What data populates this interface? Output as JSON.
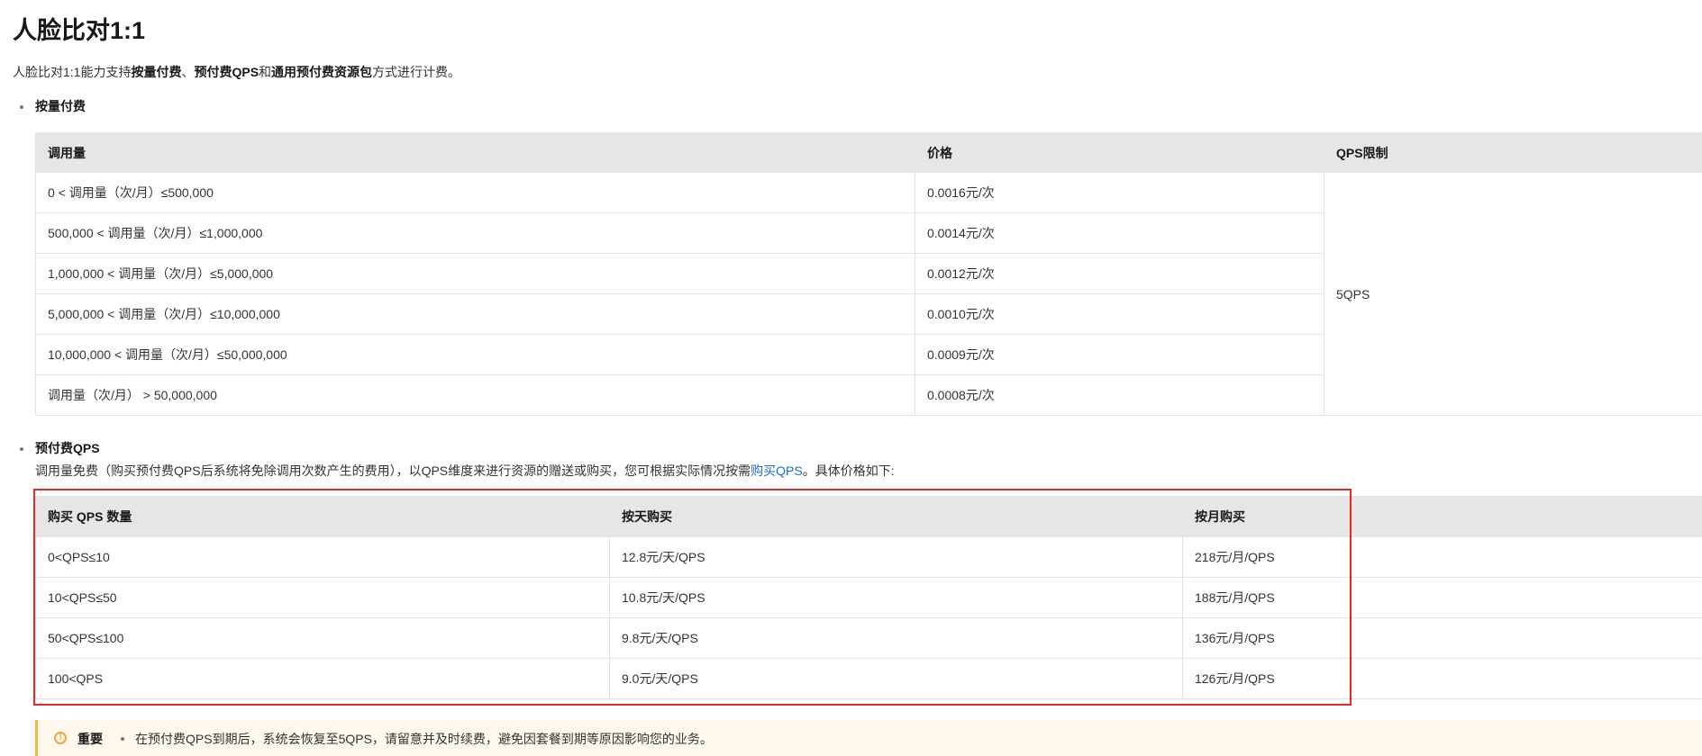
{
  "page": {
    "title": "人脸比对1:1",
    "intro": {
      "prefix": "人脸比对1:1能力支持",
      "b1": "按量付费",
      "sep1": "、",
      "b2": "预付费QPS",
      "sep2": "和",
      "b3": "通用预付费资源包",
      "suffix": "方式进行计费。"
    }
  },
  "pay_as_you_go": {
    "heading": "按量付费",
    "headers": [
      "调用量",
      "价格",
      "QPS限制"
    ],
    "rows": [
      {
        "range": "0 < 调用量（次/月）≤500,000",
        "price": "0.0016元/次"
      },
      {
        "range": "500,000 < 调用量（次/月）≤1,000,000",
        "price": "0.0014元/次"
      },
      {
        "range": "1,000,000 < 调用量（次/月）≤5,000,000",
        "price": "0.0012元/次"
      },
      {
        "range": "5,000,000 < 调用量（次/月）≤10,000,000",
        "price": "0.0010元/次"
      },
      {
        "range": "10,000,000 < 调用量（次/月）≤50,000,000",
        "price": "0.0009元/次"
      },
      {
        "range": "调用量（次/月） > 50,000,000",
        "price": "0.0008元/次"
      }
    ],
    "qps_limit": "5QPS"
  },
  "prepaid_qps": {
    "heading": "预付费QPS",
    "desc_prefix": "调用量免费（购买预付费QPS后系统将免除调用次数产生的费用），以QPS维度来进行资源的赠送或购买，您可根据实际情况按需",
    "desc_link": "购买QPS",
    "desc_suffix": "。具体价格如下:",
    "headers": [
      "购买 QPS 数量",
      "按天购买",
      "按月购买"
    ],
    "rows": [
      {
        "qty": "0<QPS≤10",
        "daily": "12.8元/天/QPS",
        "monthly": "218元/月/QPS"
      },
      {
        "qty": "10<QPS≤50",
        "daily": "10.8元/天/QPS",
        "monthly": "188元/月/QPS"
      },
      {
        "qty": "50<QPS≤100",
        "daily": "9.8元/天/QPS",
        "monthly": "136元/月/QPS"
      },
      {
        "qty": "100<QPS",
        "daily": "9.0元/天/QPS",
        "monthly": "126元/月/QPS"
      }
    ]
  },
  "notice": {
    "icon": "warning-icon",
    "label": "重要",
    "text": "在预付费QPS到期后，系统会恢复至5QPS，请留意并及时续费，避免因套餐到期等原因影响您的业务。"
  },
  "colors": {
    "header_bg": "#e6e6e6",
    "border": "#e3e3e3",
    "link": "#1f6cd6",
    "highlight": "#e8262a",
    "notice_bg": "#fff8ec",
    "notice_accent": "#f3b73c"
  }
}
